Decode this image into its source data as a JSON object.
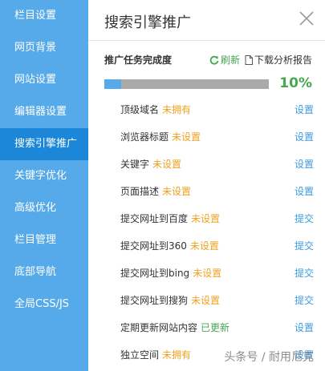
{
  "sidebar": {
    "items": [
      {
        "label": "栏目设置"
      },
      {
        "label": "网页背景"
      },
      {
        "label": "网站设置"
      },
      {
        "label": "编辑器设置"
      },
      {
        "label": "搜索引擎推广",
        "active": true
      },
      {
        "label": "关键字优化"
      },
      {
        "label": "高级优化"
      },
      {
        "label": "栏目管理"
      },
      {
        "label": "底部导航"
      },
      {
        "label": "全局CSS/JS"
      }
    ]
  },
  "panel": {
    "title": "搜索引擎推广",
    "close_icon": "close-icon"
  },
  "progress": {
    "label": "推广任务完成度",
    "refresh_label": "刷新",
    "download_label": "下载分析报告",
    "percent_text": "10%",
    "value": 0.1
  },
  "tasks": [
    {
      "name": "顶级域名",
      "status": "未拥有",
      "action": "设置"
    },
    {
      "name": "浏览器标题",
      "status": "未设置",
      "action": "设置"
    },
    {
      "name": "关键字",
      "status": "未设置",
      "action": "设置"
    },
    {
      "name": "页面描述",
      "status": "未设置",
      "action": "设置"
    },
    {
      "name": "提交网址到百度",
      "status": "未设置",
      "action": "提交"
    },
    {
      "name": "提交网址到360",
      "status": "未设置",
      "action": "提交"
    },
    {
      "name": "提交网址到bing",
      "status": "未设置",
      "action": "提交"
    },
    {
      "name": "提交网址到搜狗",
      "status": "未设置",
      "action": "提交"
    },
    {
      "name": "定期更新网站内容",
      "status": "已更新",
      "action": "设置"
    },
    {
      "name": "独立空间",
      "status": "未拥有",
      "action": "设置"
    }
  ],
  "watermark": "头条号 / 耐用尼克",
  "colors": {
    "sidebar_bg": "#56aaea",
    "sidebar_active": "#1c86d9",
    "status_pending": "#f0a120",
    "status_done": "#45a851",
    "link": "#3b9be0"
  }
}
